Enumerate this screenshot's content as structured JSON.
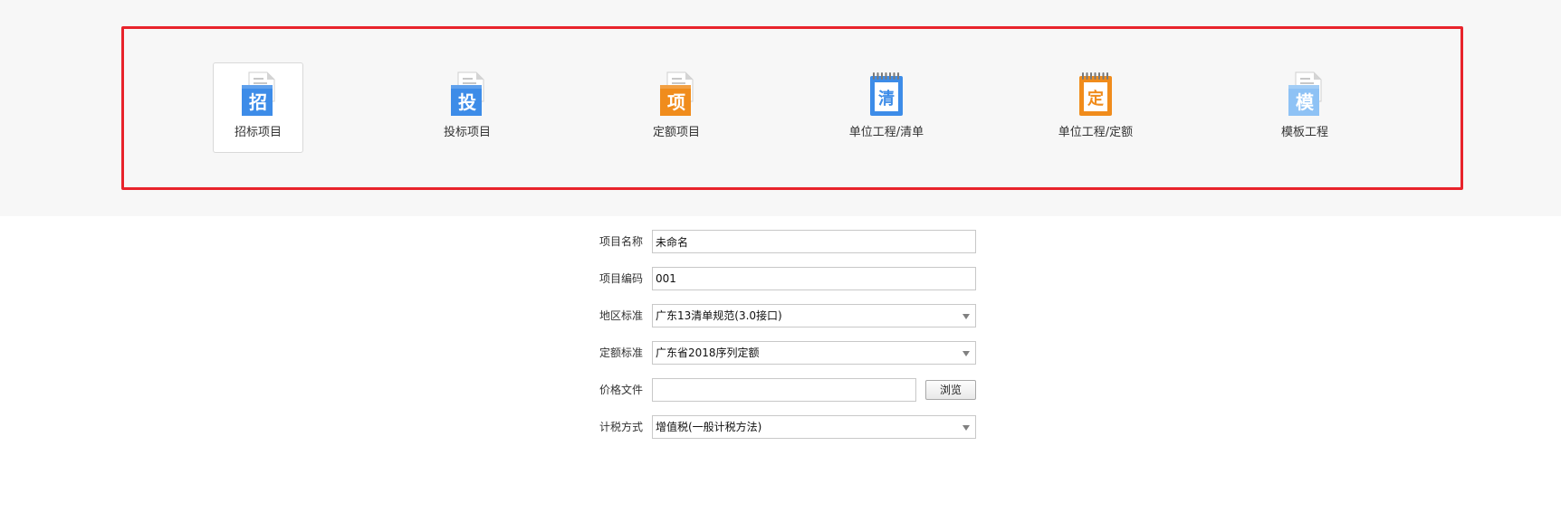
{
  "project_types": {
    "items": [
      {
        "label": "招标项目",
        "glyph": "招",
        "icon": "tender-project-icon",
        "color": "#3d8ce8",
        "style": "folder",
        "selected": true
      },
      {
        "label": "投标项目",
        "glyph": "投",
        "icon": "bid-project-icon",
        "color": "#3d8ce8",
        "style": "folder",
        "selected": false
      },
      {
        "label": "定额项目",
        "glyph": "项",
        "icon": "quota-project-icon",
        "color": "#f08c1c",
        "style": "folder",
        "selected": false
      },
      {
        "label": "单位工程/清单",
        "glyph": "清",
        "icon": "unit-bill-icon",
        "color": "#3d8ce8",
        "style": "notepad",
        "selected": false
      },
      {
        "label": "单位工程/定额",
        "glyph": "定",
        "icon": "unit-quota-icon",
        "color": "#f08c1c",
        "style": "notepad",
        "selected": false
      },
      {
        "label": "模板工程",
        "glyph": "模",
        "icon": "template-project-icon",
        "color": "#8ec2f5",
        "style": "folder",
        "selected": false
      }
    ],
    "frame_color": "#e8232b"
  },
  "form": {
    "project_name": {
      "label": "项目名称",
      "value": "未命名"
    },
    "project_code": {
      "label": "项目编码",
      "value": "001"
    },
    "region_standard": {
      "label": "地区标准",
      "value": "广东13清单规范(3.0接口)"
    },
    "quota_standard": {
      "label": "定额标准",
      "value": "广东省2018序列定额"
    },
    "price_file": {
      "label": "价格文件",
      "value": "",
      "browse_label": "浏览"
    },
    "tax_method": {
      "label": "计税方式",
      "value": "增值税(一般计税方法)"
    }
  }
}
